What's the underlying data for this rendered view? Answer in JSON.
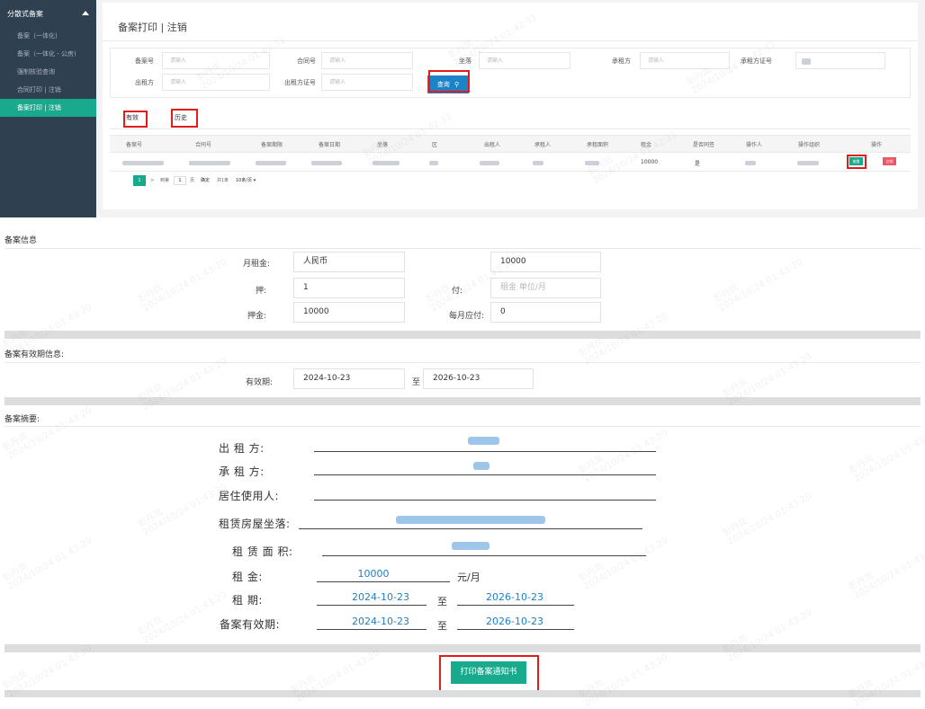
{
  "sidebar": {
    "header": "分散式备案",
    "items": [
      {
        "label": "备案（一体化)",
        "active": false
      },
      {
        "label": "备案（一体化 - 公房)",
        "active": false
      },
      {
        "label": "强制核验查询",
        "active": false
      },
      {
        "label": "合同打印 | 注销",
        "active": false
      },
      {
        "label": "备案打印 | 注销",
        "active": true
      }
    ]
  },
  "main": {
    "title": "备案打印 | 注销",
    "filters": {
      "record_no": {
        "label": "备案号",
        "placeholder": "请输入"
      },
      "contract_no": {
        "label": "合同号",
        "placeholder": "请输入"
      },
      "location": {
        "label": "坐落",
        "placeholder": "请输入"
      },
      "lessee": {
        "label": "承租方",
        "placeholder": "请输入"
      },
      "lessee_id": {
        "label": "承租方证号",
        "placeholder": ""
      },
      "lessor": {
        "label": "出租方",
        "placeholder": "请输入"
      },
      "lessor_id": {
        "label": "出租方证号",
        "placeholder": "请输入"
      },
      "query_button": "查询"
    },
    "tabs": [
      "有效",
      "历史"
    ],
    "table": {
      "headers": [
        "备案号",
        "合同号",
        "备案期限",
        "备案日期",
        "坐落",
        "区",
        "出租人",
        "承租人",
        "承租面积",
        "租金",
        "是否同签",
        "操作人",
        "操作组织",
        "操作"
      ],
      "row": {
        "rent": "10000",
        "co_sign": "是",
        "view_label": "查看",
        "cancel_label": "注销"
      }
    },
    "pager": {
      "current": "1",
      "goto_label": "到第",
      "page_input": "1",
      "page_unit": "页",
      "confirm": "确定",
      "total": "共1条",
      "page_size": "10条/页"
    }
  },
  "record_info": {
    "title": "备案信息",
    "monthly_rent_label": "月租金:",
    "currency": "人民币",
    "monthly_rent_value": "10000",
    "deposit_months_label": "押:",
    "deposit_months_value": "1",
    "pay_label": "付:",
    "pay_placeholder": "租金 单位/月",
    "deposit_label": "押金:",
    "deposit_value": "10000",
    "monthly_due_label": "每月应付:",
    "monthly_due_value": "0"
  },
  "validity": {
    "title": "备案有效期信息:",
    "label": "有效期:",
    "start": "2024-10-23",
    "to": "至",
    "end": "2026-10-23"
  },
  "summary": {
    "title": "备案摘要:",
    "lessor_label": "出   租   方:",
    "lessee_label": "承   租   方:",
    "occupant_label": "居住使用人:",
    "address_label": "租赁房屋坐落:",
    "area_label": "租 赁 面 积:",
    "rent_label": "租          金:",
    "rent_value": "10000",
    "rent_unit": "元/月",
    "term_label": "租          期:",
    "term_start": "2024-10-23",
    "term_to": "至",
    "term_end": "2026-10-23",
    "valid_label": "备案有效期:",
    "valid_start": "2024-10-23",
    "valid_to": "至",
    "valid_end": "2026-10-23"
  },
  "print_button": "打印备案通知书",
  "watermark": {
    "name": "彭丹凤",
    "time_a": "2024/10/24 01:42:33",
    "time_b": "2024/10/24 01:43:20"
  },
  "colors": {
    "sidebar": "#2f4050",
    "accent_green": "#19aa8d",
    "query_blue": "#1c84c6",
    "highlight_red": "#e21b1b",
    "cancel_red": "#ed5565"
  }
}
